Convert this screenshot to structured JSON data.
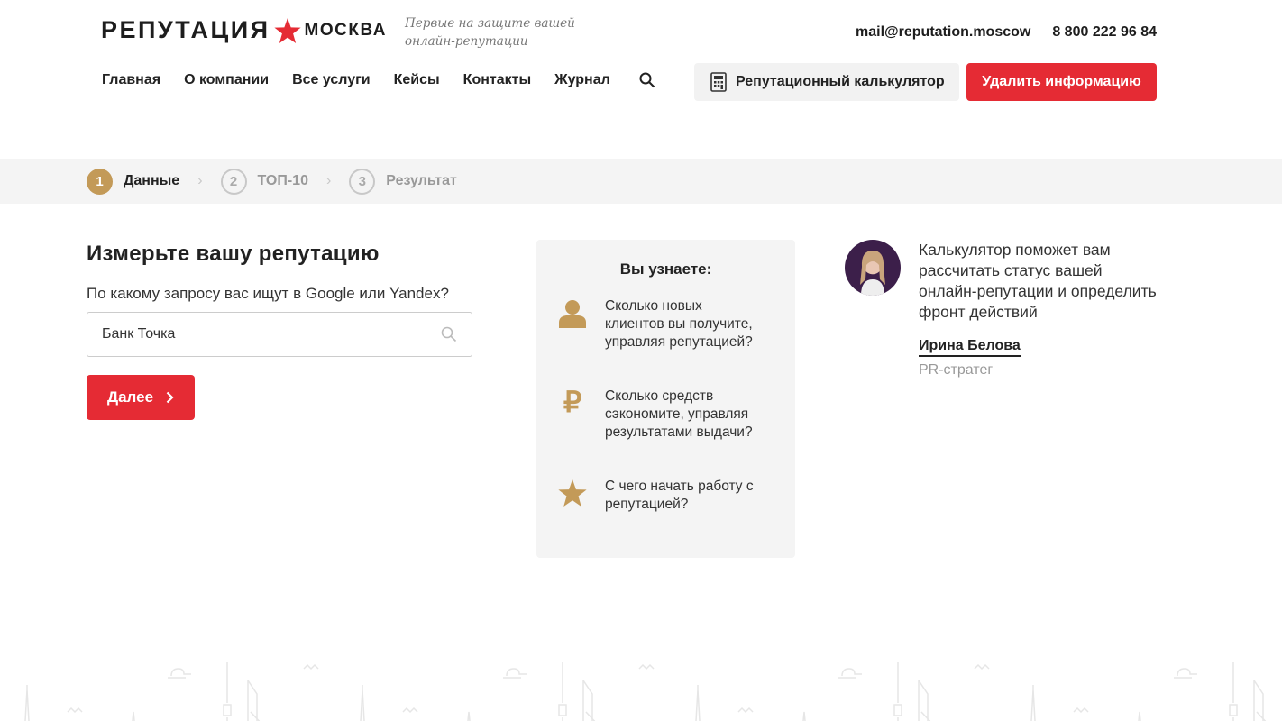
{
  "header": {
    "logo": {
      "word1": "РЕПУТАЦИЯ",
      "word2": "МОСКВА"
    },
    "tagline": [
      "Первые на защите вашей",
      "онлайн-репутации"
    ],
    "email": "mail@reputation.moscow",
    "phone": "8 800 222 96 84",
    "nav": [
      "Главная",
      "О компании",
      "Все услуги",
      "Кейсы",
      "Контакты",
      "Журнал"
    ],
    "calc_button": "Репутационный калькулятор",
    "delete_button": "Удалить информацию"
  },
  "steps": [
    {
      "num": "1",
      "label": "Данные",
      "active": true
    },
    {
      "num": "2",
      "label": "ТОП-10",
      "active": false
    },
    {
      "num": "3",
      "label": "Результат",
      "active": false
    }
  ],
  "form": {
    "title": "Измерьте вашу репутацию",
    "question": "По какому запросу вас ищут в Google или Yandex?",
    "query_value": "Банк Точка",
    "next_button": "Далее"
  },
  "card": {
    "title": "Вы узнаете:",
    "items": [
      {
        "icon": "user-icon",
        "lines": [
          "Сколько новых",
          "клиентов вы получите,",
          "управляя репутацией?"
        ]
      },
      {
        "icon": "ruble-icon",
        "lines": [
          "Сколько средств",
          "сэкономите, управляя",
          "результатами выдачи?"
        ]
      },
      {
        "icon": "star-icon",
        "lines": [
          "С чего начать работу с",
          "репутацией?"
        ]
      }
    ]
  },
  "expert": {
    "quote": [
      "Калькулятор поможет вам",
      "рассчитать статус вашей",
      "онлайн-репутации и определить",
      "фронт действий"
    ],
    "name": "Ирина Белова",
    "role": "PR-стратег"
  },
  "colors": {
    "accent": "#e52b34",
    "gold": "#c39a58"
  }
}
